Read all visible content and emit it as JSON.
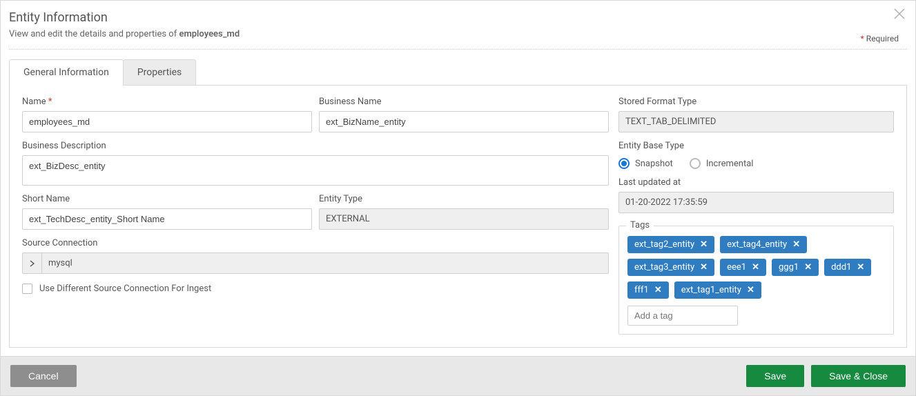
{
  "header": {
    "title": "Entity Information",
    "subtitle_prefix": "View and edit the details and properties of ",
    "subtitle_entity": "employees_md",
    "required_label": "Required"
  },
  "tabs": {
    "general": "General Information",
    "properties": "Properties"
  },
  "fields": {
    "name_label": "Name",
    "name_value": "employees_md",
    "business_name_label": "Business Name",
    "business_name_value": "ext_BizName_entity",
    "stored_format_label": "Stored Format Type",
    "stored_format_value": "TEXT_TAB_DELIMITED",
    "business_desc_label": "Business Description",
    "business_desc_value": "ext_BizDesc_entity",
    "entity_base_type_label": "Entity Base Type",
    "radio_snapshot": "Snapshot",
    "radio_incremental": "Incremental",
    "short_name_label": "Short Name",
    "short_name_value": "ext_TechDesc_entity_Short Name",
    "entity_type_label": "Entity Type",
    "entity_type_value": "EXTERNAL",
    "last_updated_label": "Last updated at",
    "last_updated_value": "01-20-2022 17:35:59",
    "source_conn_label": "Source Connection",
    "source_conn_value": "mysql",
    "checkbox_label": "Use Different Source Connection For Ingest"
  },
  "tags": {
    "legend": "Tags",
    "items": [
      "ext_tag2_entity",
      "ext_tag4_entity",
      "ext_tag3_entity",
      "eee1",
      "ggg1",
      "ddd1",
      "fff1",
      "ext_tag1_entity"
    ],
    "add_placeholder": "Add a tag"
  },
  "footer": {
    "cancel": "Cancel",
    "save": "Save",
    "save_close": "Save & Close"
  }
}
